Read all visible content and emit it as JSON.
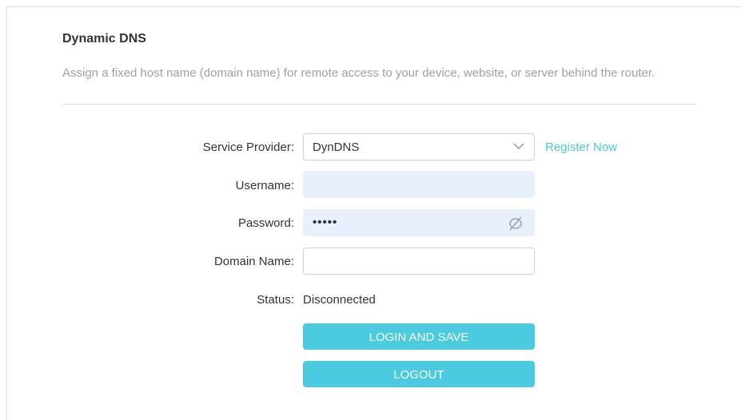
{
  "section": {
    "title": "Dynamic DNS",
    "description": "Assign a fixed host name (domain name) for remote access to your device, website, or server behind the router."
  },
  "form": {
    "service_provider": {
      "label": "Service Provider:",
      "value": "DynDNS",
      "link": "Register Now"
    },
    "username": {
      "label": "Username:",
      "value": ""
    },
    "password": {
      "label": "Password:",
      "value": "•••••"
    },
    "domain_name": {
      "label": "Domain Name:",
      "value": ""
    },
    "status": {
      "label": "Status:",
      "value": "Disconnected"
    }
  },
  "buttons": {
    "login_save": "LOGIN AND SAVE",
    "logout": "LOGOUT"
  },
  "colors": {
    "accent": "#4acbdf",
    "link": "#4acbd6",
    "autofill_bg": "#e8f0fe"
  },
  "icons": {
    "select": "chevron-down-icon",
    "password_toggle": "eye-off-icon"
  }
}
